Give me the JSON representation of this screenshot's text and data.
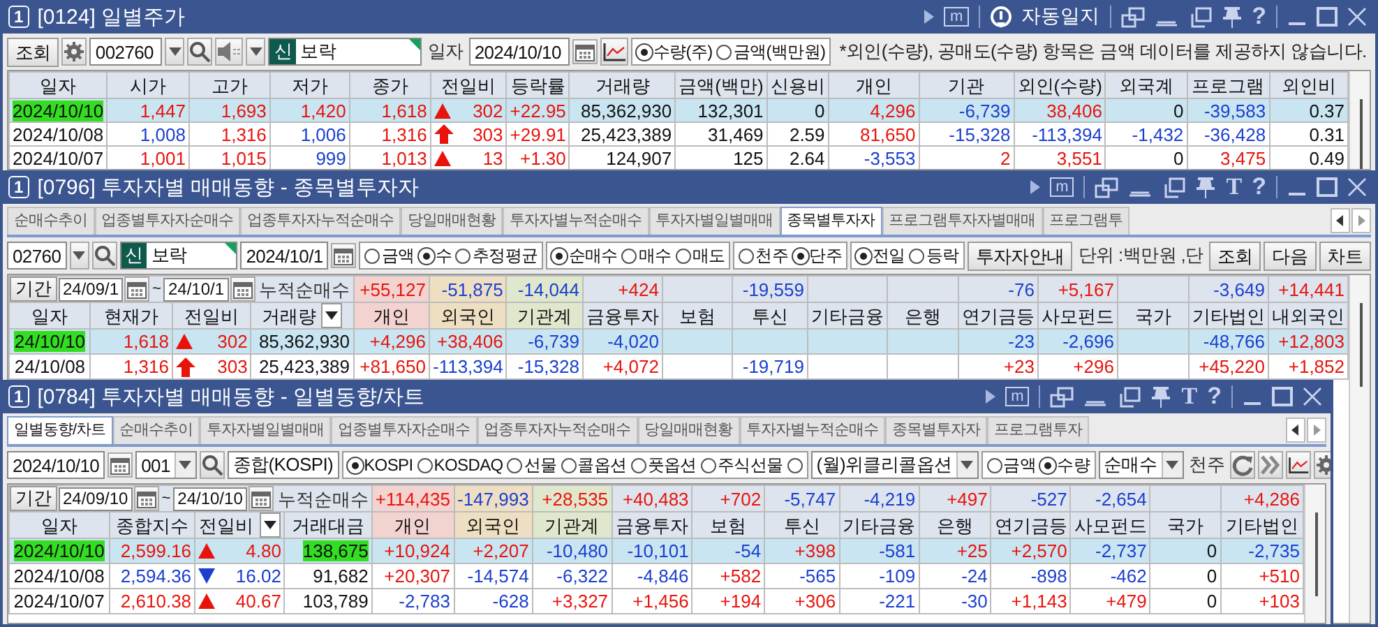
{
  "windows": [
    {
      "number": "1",
      "title": "[0124] 일별주가",
      "title_tools": [
        {
          "kind": "more"
        },
        {
          "kind": "memo",
          "label": "m"
        },
        {
          "kind": "separator"
        },
        {
          "kind": "autolog",
          "label": "자동일지"
        },
        {
          "kind": "separator"
        },
        {
          "kind": "float"
        },
        {
          "kind": "tray"
        },
        {
          "kind": "restore"
        },
        {
          "kind": "pin"
        },
        {
          "kind": "help",
          "label": "?"
        },
        {
          "kind": "separator"
        },
        {
          "kind": "minimize"
        },
        {
          "kind": "maximize"
        },
        {
          "kind": "close"
        }
      ],
      "toolbar": [
        {
          "kind": "button",
          "label": "조회"
        },
        {
          "kind": "settings"
        },
        {
          "kind": "code-field",
          "value": "002760"
        },
        {
          "kind": "dropdown"
        },
        {
          "kind": "search"
        },
        {
          "kind": "speaker"
        },
        {
          "kind": "dropdown"
        },
        {
          "kind": "stock-field",
          "badge": "신",
          "value": "보락"
        },
        {
          "kind": "label",
          "text": "일자"
        },
        {
          "kind": "date-field",
          "value": "2024/10/10"
        },
        {
          "kind": "calendar"
        },
        {
          "kind": "chart"
        },
        {
          "kind": "radios",
          "options": [
            {
              "label": "수량(주)",
              "selected": true
            },
            {
              "label": "금액(백만원)",
              "selected": false
            }
          ]
        },
        {
          "kind": "note",
          "text": "*외인(수량), 공매도(수량) 항목은 금액 데이터를 제공하지 않습니다."
        }
      ],
      "table": {
        "columns": [
          {
            "label": "일자"
          },
          {
            "label": "시가"
          },
          {
            "label": "고가"
          },
          {
            "label": "저가"
          },
          {
            "label": "종가"
          },
          {
            "label": "전일비"
          },
          {
            "label": "등락률"
          },
          {
            "label": "거래량"
          },
          {
            "label": "금액(백만)"
          },
          {
            "label": "신용비"
          },
          {
            "label": "개인"
          },
          {
            "label": "기관"
          },
          {
            "label": "외인(수량)"
          },
          {
            "label": "외국계"
          },
          {
            "label": "프로그램"
          },
          {
            "label": "외인비"
          }
        ],
        "rows": [
          {
            "selected": true,
            "cells": [
              {
                "text": "2024/10/10",
                "marked": true
              },
              {
                "text": "1,447",
                "color": "#e8140c"
              },
              {
                "text": "1,693",
                "color": "#e8140c"
              },
              {
                "text": "1,420",
                "color": "#e8140c"
              },
              {
                "text": "1,618",
                "color": "#e8140c"
              },
              {
                "text": "302",
                "color": "#e8140c",
                "kind": "rise"
              },
              {
                "text": "+22.95",
                "color": "#e8140c"
              },
              {
                "text": "85,362,930"
              },
              {
                "text": "132,301"
              },
              {
                "text": "0"
              },
              {
                "text": "4,296",
                "color": "#e8140c"
              },
              {
                "text": "-6,739",
                "color": "#1a3fd0"
              },
              {
                "text": "38,406",
                "color": "#e8140c"
              },
              {
                "text": "0"
              },
              {
                "text": "-39,583",
                "color": "#1a3fd0"
              },
              {
                "text": "0.37"
              }
            ]
          },
          {
            "selected": false,
            "cells": [
              {
                "text": "2024/10/08"
              },
              {
                "text": "1,008",
                "color": "#1a3fd0"
              },
              {
                "text": "1,316",
                "color": "#e8140c"
              },
              {
                "text": "1,006",
                "color": "#1a3fd0"
              },
              {
                "text": "1,316",
                "color": "#e8140c"
              },
              {
                "text": "303",
                "color": "#e8140c",
                "kind": "limit"
              },
              {
                "text": "+29.91",
                "color": "#e8140c"
              },
              {
                "text": "25,423,389"
              },
              {
                "text": "31,469"
              },
              {
                "text": "2.59"
              },
              {
                "text": "81,650",
                "color": "#e8140c"
              },
              {
                "text": "-15,328",
                "color": "#1a3fd0"
              },
              {
                "text": "-113,394",
                "color": "#1a3fd0"
              },
              {
                "text": "-1,432",
                "color": "#1a3fd0"
              },
              {
                "text": "-36,428",
                "color": "#1a3fd0"
              },
              {
                "text": "0.31"
              }
            ]
          },
          {
            "selected": false,
            "cells": [
              {
                "text": "2024/10/07"
              },
              {
                "text": "1,001",
                "color": "#e8140c"
              },
              {
                "text": "1,015",
                "color": "#e8140c"
              },
              {
                "text": "999",
                "color": "#1a3fd0"
              },
              {
                "text": "1,013",
                "color": "#e8140c"
              },
              {
                "text": "13",
                "color": "#e8140c",
                "kind": "rise"
              },
              {
                "text": "+1.30",
                "color": "#e8140c"
              },
              {
                "text": "124,907"
              },
              {
                "text": "125"
              },
              {
                "text": "2.64"
              },
              {
                "text": "-3,553",
                "color": "#1a3fd0"
              },
              {
                "text": "2",
                "color": "#e8140c"
              },
              {
                "text": "3,551",
                "color": "#e8140c"
              },
              {
                "text": "0"
              },
              {
                "text": "3,475",
                "color": "#e8140c"
              },
              {
                "text": "0.49"
              }
            ]
          }
        ]
      }
    },
    {
      "number": "1",
      "title": "[0796] 투자자별 매매동향 - 종목별투자자",
      "title_tools": [
        {
          "kind": "more"
        },
        {
          "kind": "memo",
          "label": "m"
        },
        {
          "kind": "separator"
        },
        {
          "kind": "float"
        },
        {
          "kind": "tray"
        },
        {
          "kind": "restore"
        },
        {
          "kind": "pin"
        },
        {
          "kind": "font",
          "label": "T"
        },
        {
          "kind": "help",
          "label": "?"
        },
        {
          "kind": "separator"
        },
        {
          "kind": "minimize"
        },
        {
          "kind": "maximize"
        },
        {
          "kind": "close"
        }
      ],
      "tabs": [
        {
          "label": "순매수추이",
          "selected": false
        },
        {
          "label": "업종별투자자순매수",
          "selected": false
        },
        {
          "label": "업종투자자누적순매수",
          "selected": false
        },
        {
          "label": "당일매매현황",
          "selected": false
        },
        {
          "label": "투자자별누적순매수",
          "selected": false
        },
        {
          "label": "투자자별일별매매",
          "selected": false
        },
        {
          "label": "종목별투자자",
          "selected": true
        },
        {
          "label": "프로그램투자자별매매",
          "selected": false
        },
        {
          "label": "프로그램투",
          "selected": false
        }
      ],
      "toolbar": [
        {
          "kind": "code-field",
          "value": "02760"
        },
        {
          "kind": "dropdown"
        },
        {
          "kind": "search"
        },
        {
          "kind": "stock-field",
          "badge": "신",
          "value": "보락"
        },
        {
          "kind": "date-field",
          "value": "2024/10/1"
        },
        {
          "kind": "calendar"
        },
        {
          "kind": "radios",
          "options": [
            {
              "label": "금액",
              "selected": false
            },
            {
              "label": "수",
              "selected": true
            },
            {
              "label": "추정평균",
              "selected": false
            }
          ]
        },
        {
          "kind": "radios",
          "options": [
            {
              "label": "순매수",
              "selected": true
            },
            {
              "label": "매수",
              "selected": false
            },
            {
              "label": "매도",
              "selected": false
            }
          ]
        },
        {
          "kind": "radios",
          "options": [
            {
              "label": "천주",
              "selected": false
            },
            {
              "label": "단주",
              "selected": true
            }
          ]
        },
        {
          "kind": "radios",
          "options": [
            {
              "label": "전일",
              "selected": true
            },
            {
              "label": "등락",
              "selected": false
            }
          ]
        },
        {
          "kind": "button",
          "label": "투자자안내"
        },
        {
          "kind": "label",
          "text": "단위 :백만원 ,단"
        },
        {
          "kind": "button",
          "label": "조회"
        },
        {
          "kind": "button",
          "label": "다음"
        },
        {
          "kind": "button",
          "label": "차트"
        }
      ],
      "table": {
        "period": {
          "button": "기간",
          "from": "24/09/1",
          "separator": "~",
          "to": "24/10/1",
          "label": "누적순매수"
        },
        "columns": [
          {
            "label": "일자"
          },
          {
            "label": "현재가"
          },
          {
            "label": "전일비"
          },
          {
            "label": "거래량",
            "menu": true
          },
          {
            "label": "개인",
            "color": "#f3d3d0",
            "total": {
              "text": "+55,127",
              "color": "#e8140c"
            }
          },
          {
            "label": "외국인",
            "color": "#efdfc2",
            "total": {
              "text": "-51,875",
              "color": "#1a3fd0"
            }
          },
          {
            "label": "기관계",
            "color": "#dfe8cc",
            "total": {
              "text": "-14,044",
              "color": "#1a3fd0"
            }
          },
          {
            "label": "금융투자",
            "total": {
              "text": "+424",
              "color": "#e8140c"
            }
          },
          {
            "label": "보험"
          },
          {
            "label": "투신",
            "total": {
              "text": "-19,559",
              "color": "#1a3fd0"
            }
          },
          {
            "label": "기타금융"
          },
          {
            "label": "은행"
          },
          {
            "label": "연기금등",
            "total": {
              "text": "-76",
              "color": "#1a3fd0"
            }
          },
          {
            "label": "사모펀드",
            "total": {
              "text": "+5,167",
              "color": "#e8140c"
            }
          },
          {
            "label": "국가"
          },
          {
            "label": "기타법인",
            "total": {
              "text": "-3,649",
              "color": "#1a3fd0"
            }
          },
          {
            "label": "내외국인",
            "total": {
              "text": "+14,441",
              "color": "#e8140c"
            }
          }
        ],
        "rows": [
          {
            "selected": true,
            "cells": [
              {
                "text": "24/10/10",
                "marked": true
              },
              {
                "text": "1,618",
                "color": "#e8140c"
              },
              {
                "text": "302",
                "color": "#e8140c",
                "kind": "rise"
              },
              {
                "text": "85,362,930"
              },
              {
                "text": "+4,296",
                "color": "#e8140c"
              },
              {
                "text": "+38,406",
                "color": "#e8140c"
              },
              {
                "text": "-6,739",
                "color": "#1a3fd0"
              },
              {
                "text": "-4,020",
                "color": "#1a3fd0"
              },
              {},
              {},
              {},
              {},
              {
                "text": "-23",
                "color": "#1a3fd0"
              },
              {
                "text": "-2,696",
                "color": "#1a3fd0"
              },
              {},
              {
                "text": "-48,766",
                "color": "#1a3fd0"
              },
              {
                "text": "+12,803",
                "color": "#e8140c"
              }
            ]
          },
          {
            "selected": false,
            "cells": [
              {
                "text": "24/10/08"
              },
              {
                "text": "1,316",
                "color": "#e8140c"
              },
              {
                "text": "303",
                "color": "#e8140c",
                "kind": "limit"
              },
              {
                "text": "25,423,389"
              },
              {
                "text": "+81,650",
                "color": "#e8140c"
              },
              {
                "text": "-113,394",
                "color": "#1a3fd0"
              },
              {
                "text": "-15,328",
                "color": "#1a3fd0"
              },
              {
                "text": "+4,072",
                "color": "#e8140c"
              },
              {},
              {
                "text": "-19,719",
                "color": "#1a3fd0"
              },
              {},
              {},
              {
                "text": "+23",
                "color": "#e8140c"
              },
              {
                "text": "+296",
                "color": "#e8140c"
              },
              {},
              {
                "text": "+45,220",
                "color": "#e8140c"
              },
              {
                "text": "+1,852",
                "color": "#e8140c"
              }
            ]
          }
        ]
      }
    },
    {
      "number": "1",
      "title": "[0784] 투자자별 매매동향 - 일별동향/차트",
      "title_tools": [
        {
          "kind": "more"
        },
        {
          "kind": "memo",
          "label": "m"
        },
        {
          "kind": "separator"
        },
        {
          "kind": "float"
        },
        {
          "kind": "tray"
        },
        {
          "kind": "restore"
        },
        {
          "kind": "pin"
        },
        {
          "kind": "font",
          "label": "T"
        },
        {
          "kind": "help",
          "label": "?"
        },
        {
          "kind": "separator"
        },
        {
          "kind": "minimize"
        },
        {
          "kind": "maximize"
        },
        {
          "kind": "close"
        }
      ],
      "tabs": [
        {
          "label": "일별동향/차트",
          "selected": true
        },
        {
          "label": "순매수추이",
          "selected": false
        },
        {
          "label": "투자자별일별매매",
          "selected": false
        },
        {
          "label": "업종별투자자순매수",
          "selected": false
        },
        {
          "label": "업종투자자누적순매수",
          "selected": false
        },
        {
          "label": "당일매매현황",
          "selected": false
        },
        {
          "label": "투자자별누적순매수",
          "selected": false
        },
        {
          "label": "종목별투자자",
          "selected": false
        },
        {
          "label": "프로그램투자",
          "selected": false
        }
      ],
      "toolbar": [
        {
          "kind": "date-field",
          "value": "2024/10/10"
        },
        {
          "kind": "calendar"
        },
        {
          "kind": "combo",
          "value": "001"
        },
        {
          "kind": "search"
        },
        {
          "kind": "name-field",
          "value": "종합(KOSPI)"
        },
        {
          "kind": "radios",
          "options": [
            {
              "label": "KOSPI",
              "selected": true
            },
            {
              "label": "KOSDAQ",
              "selected": false
            },
            {
              "label": "선물",
              "selected": false
            },
            {
              "label": "콜옵션",
              "selected": false
            },
            {
              "label": "풋옵션",
              "selected": false
            },
            {
              "label": "주식선물",
              "selected": false
            },
            {
              "selected": false
            }
          ]
        },
        {
          "kind": "combo",
          "value": "(월)위클리콜옵션"
        },
        {
          "kind": "radios",
          "options": [
            {
              "label": "금액",
              "selected": false
            },
            {
              "label": "수량",
              "selected": true
            }
          ]
        },
        {
          "kind": "combo",
          "value": "순매수"
        },
        {
          "kind": "label",
          "text": "천주"
        },
        {
          "kind": "refresh"
        },
        {
          "kind": "forward"
        },
        {
          "kind": "chart"
        },
        {
          "kind": "settings"
        }
      ],
      "table": {
        "period": {
          "button": "기간",
          "from": "24/09/10",
          "separator": "~",
          "to": "24/10/10",
          "label": "누적순매수"
        },
        "columns": [
          {
            "label": "일자"
          },
          {
            "label": "종합지수"
          },
          {
            "label": "전일비",
            "menu": true
          },
          {
            "label": "거래대금"
          },
          {
            "label": "개인",
            "color": "#f3d3d0",
            "total": {
              "text": "+114,435",
              "color": "#e8140c"
            }
          },
          {
            "label": "외국인",
            "color": "#efdfc2",
            "total": {
              "text": "-147,993",
              "color": "#1a3fd0"
            }
          },
          {
            "label": "기관계",
            "color": "#dfe8cc",
            "total": {
              "text": "+28,535",
              "color": "#e8140c"
            }
          },
          {
            "label": "금융투자",
            "total": {
              "text": "+40,483",
              "color": "#e8140c"
            }
          },
          {
            "label": "보험",
            "total": {
              "text": "+702",
              "color": "#e8140c"
            }
          },
          {
            "label": "투신",
            "total": {
              "text": "-5,747",
              "color": "#1a3fd0"
            }
          },
          {
            "label": "기타금융",
            "total": {
              "text": "-4,219",
              "color": "#1a3fd0"
            }
          },
          {
            "label": "은행",
            "total": {
              "text": "+497",
              "color": "#e8140c"
            }
          },
          {
            "label": "연기금등",
            "total": {
              "text": "-527",
              "color": "#1a3fd0"
            }
          },
          {
            "label": "사모펀드",
            "total": {
              "text": "-2,654",
              "color": "#1a3fd0"
            }
          },
          {
            "label": "국가"
          },
          {
            "label": "기타법인",
            "total": {
              "text": "+4,286",
              "color": "#e8140c"
            }
          }
        ],
        "rows": [
          {
            "selected": true,
            "cells": [
              {
                "text": "2024/10/10",
                "marked": true
              },
              {
                "text": "2,599.16",
                "color": "#e8140c"
              },
              {
                "text": "4.80",
                "color": "#e8140c",
                "kind": "rise"
              },
              {
                "text": "138,675",
                "marked": true
              },
              {
                "text": "+10,924",
                "color": "#e8140c"
              },
              {
                "text": "+2,207",
                "color": "#e8140c"
              },
              {
                "text": "-10,480",
                "color": "#1a3fd0"
              },
              {
                "text": "-10,101",
                "color": "#1a3fd0"
              },
              {
                "text": "-54",
                "color": "#1a3fd0"
              },
              {
                "text": "+398",
                "color": "#e8140c"
              },
              {
                "text": "-581",
                "color": "#1a3fd0"
              },
              {
                "text": "+25",
                "color": "#e8140c"
              },
              {
                "text": "+2,570",
                "color": "#e8140c"
              },
              {
                "text": "-2,737",
                "color": "#1a3fd0"
              },
              {
                "text": "0"
              },
              {
                "text": "-2,735",
                "color": "#1a3fd0"
              }
            ]
          },
          {
            "selected": false,
            "cells": [
              {
                "text": "2024/10/08"
              },
              {
                "text": "2,594.36",
                "color": "#1a3fd0"
              },
              {
                "text": "16.02",
                "color": "#1a3fd0",
                "kind": "fall"
              },
              {
                "text": "91,682"
              },
              {
                "text": "+20,307",
                "color": "#e8140c"
              },
              {
                "text": "-14,574",
                "color": "#1a3fd0"
              },
              {
                "text": "-6,322",
                "color": "#1a3fd0"
              },
              {
                "text": "-4,846",
                "color": "#1a3fd0"
              },
              {
                "text": "+582",
                "color": "#e8140c"
              },
              {
                "text": "-565",
                "color": "#1a3fd0"
              },
              {
                "text": "-109",
                "color": "#1a3fd0"
              },
              {
                "text": "-24",
                "color": "#1a3fd0"
              },
              {
                "text": "-898",
                "color": "#1a3fd0"
              },
              {
                "text": "-462",
                "color": "#1a3fd0"
              },
              {
                "text": "0"
              },
              {
                "text": "+510",
                "color": "#e8140c"
              }
            ]
          },
          {
            "selected": false,
            "cells": [
              {
                "text": "2024/10/07"
              },
              {
                "text": "2,610.38",
                "color": "#e8140c"
              },
              {
                "text": "40.67",
                "color": "#e8140c",
                "kind": "rise"
              },
              {
                "text": "103,789"
              },
              {
                "text": "-2,783",
                "color": "#1a3fd0"
              },
              {
                "text": "-628",
                "color": "#1a3fd0"
              },
              {
                "text": "+3,327",
                "color": "#e8140c"
              },
              {
                "text": "+1,456",
                "color": "#e8140c"
              },
              {
                "text": "+194",
                "color": "#e8140c"
              },
              {
                "text": "+306",
                "color": "#e8140c"
              },
              {
                "text": "-221",
                "color": "#1a3fd0"
              },
              {
                "text": "-30",
                "color": "#1a3fd0"
              },
              {
                "text": "+1,143",
                "color": "#e8140c"
              },
              {
                "text": "+479",
                "color": "#e8140c"
              },
              {
                "text": "0"
              },
              {
                "text": "+103",
                "color": "#e8140c"
              }
            ]
          }
        ]
      }
    }
  ]
}
